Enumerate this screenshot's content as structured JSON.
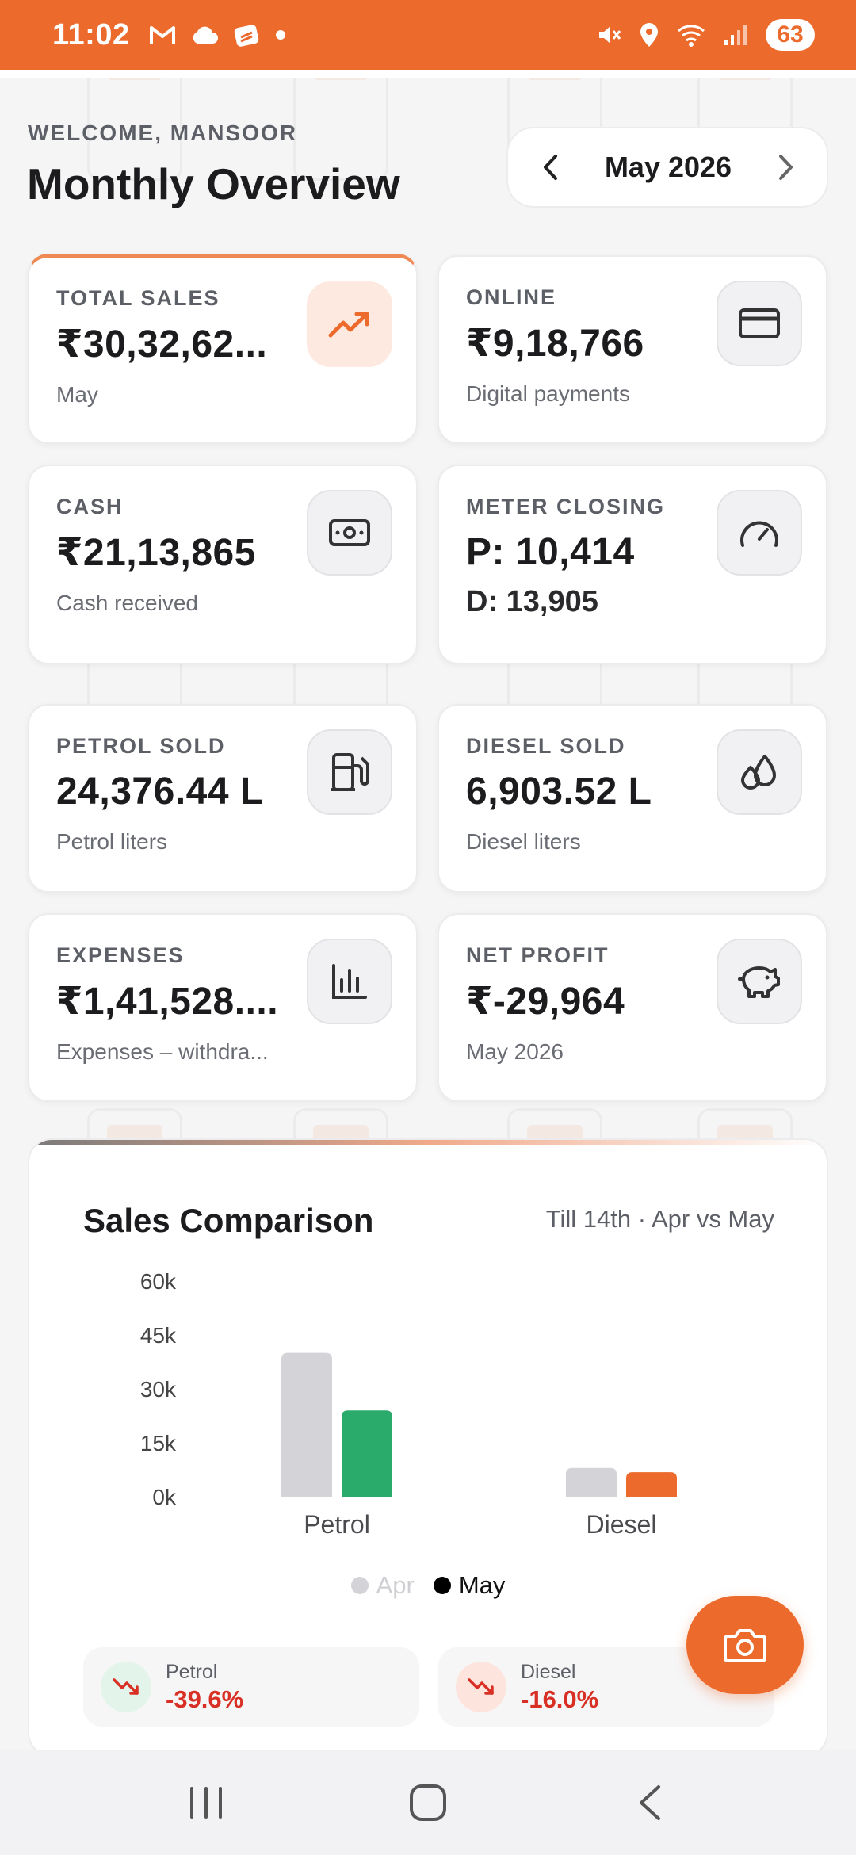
{
  "status_bar": {
    "time": "11:02",
    "battery": "63",
    "icons": [
      "gmail-icon",
      "cloud-icon",
      "app-icon",
      "dot-icon",
      "mute-icon",
      "location-icon",
      "wifi-icon",
      "signal-icon"
    ]
  },
  "header": {
    "welcome": "WELCOME, MANSOOR",
    "title": "Monthly Overview"
  },
  "month_picker": {
    "label": "May 2026",
    "prev_icon": "chevron-left-icon",
    "next_icon": "chevron-right-icon"
  },
  "cards": {
    "total_sales": {
      "label": "TOTAL SALES",
      "value": "₹30,32,62...",
      "sub": "May",
      "icon": "trending-up-icon"
    },
    "online": {
      "label": "ONLINE",
      "value": "₹9,18,766",
      "sub": "Digital payments",
      "icon": "credit-card-icon"
    },
    "cash": {
      "label": "CASH",
      "value": "₹21,13,865",
      "sub": "Cash received",
      "icon": "banknote-icon"
    },
    "meter_closing": {
      "label": "METER CLOSING",
      "value": "P: 10,414",
      "sub": "D: 13,905",
      "icon": "gauge-icon"
    },
    "petrol_sold": {
      "label": "PETROL SOLD",
      "value": "24,376.44 L",
      "sub": "Petrol liters",
      "icon": "fuel-pump-icon"
    },
    "diesel_sold": {
      "label": "DIESEL SOLD",
      "value": "6,903.52 L",
      "sub": "Diesel liters",
      "icon": "droplets-icon"
    },
    "expenses": {
      "label": "EXPENSES",
      "value": "₹1,41,528....",
      "sub": "Expenses – withdra...",
      "icon": "bar-chart-icon"
    },
    "net_profit": {
      "label": "NET PROFIT",
      "value": "₹-29,964",
      "sub": "May 2026",
      "icon": "piggy-bank-icon"
    }
  },
  "comparison": {
    "title": "Sales Comparison",
    "subtitle": "Till 14th · Apr vs May",
    "changes": [
      {
        "name": "Petrol",
        "value": "-39.6%",
        "icon": "trending-down-icon"
      },
      {
        "name": "Diesel",
        "value": "-16.0%",
        "icon": "trending-down-icon"
      }
    ]
  },
  "chart_data": {
    "type": "bar",
    "categories": [
      "Petrol",
      "Diesel"
    ],
    "series": [
      {
        "name": "Apr",
        "values": [
          40000,
          8000
        ],
        "color": "#d4d4d8"
      },
      {
        "name": "May",
        "values": [
          24000,
          6800
        ],
        "colors": [
          "#2bab6b",
          "#ec6a2c"
        ]
      }
    ],
    "y_ticks": [
      "60k",
      "45k",
      "30k",
      "15k",
      "0k"
    ],
    "ylim": [
      0,
      60000
    ],
    "legend_placement": "bottom-center"
  },
  "fab": {
    "icon": "camera-icon"
  },
  "nav": {
    "icons": [
      "recent-apps-icon",
      "home-icon",
      "back-icon"
    ]
  },
  "colors": {
    "accent": "#ec6a2c",
    "negative": "#d93025",
    "petrol_may": "#2bab6b"
  }
}
